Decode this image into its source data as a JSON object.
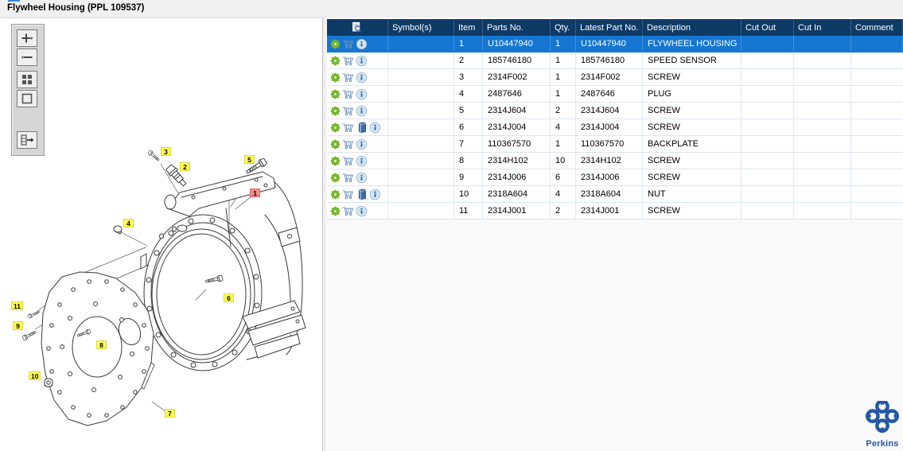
{
  "window": {
    "title": "Flywheel Housing (PPL 109537)"
  },
  "toolbar": {
    "buttons": [
      {
        "name": "zoom-in"
      },
      {
        "name": "zoom-out"
      },
      {
        "name": "zoom-fit"
      },
      {
        "name": "zoom-full-view"
      },
      {
        "name": "toggle-parts-panel"
      }
    ]
  },
  "diagram": {
    "callouts": [
      {
        "label": "1",
        "selected": true
      },
      {
        "label": "2"
      },
      {
        "label": "3"
      },
      {
        "label": "4"
      },
      {
        "label": "5"
      },
      {
        "label": "6"
      },
      {
        "label": "7"
      },
      {
        "label": "8"
      },
      {
        "label": "9"
      },
      {
        "label": "10"
      },
      {
        "label": "11"
      }
    ]
  },
  "table": {
    "columns": [
      "Symbol(s)",
      "Item",
      "Parts No.",
      "Qty.",
      "Latest Part No.",
      "Description",
      "Cut Out",
      "Cut In",
      "Comment"
    ],
    "rows": [
      {
        "item": "1",
        "parts_no": "U10447940",
        "qty": "1",
        "latest_part_no": "U10447940",
        "description": "FLYWHEEL HOUSING",
        "symbols": "",
        "cut_out": "",
        "cut_in": "",
        "comment": "",
        "selected": true,
        "has_book": false
      },
      {
        "item": "2",
        "parts_no": "185746180",
        "qty": "1",
        "latest_part_no": "185746180",
        "description": "SPEED SENSOR",
        "symbols": "",
        "cut_out": "",
        "cut_in": "",
        "comment": "",
        "selected": false,
        "has_book": false
      },
      {
        "item": "3",
        "parts_no": "2314F002",
        "qty": "1",
        "latest_part_no": "2314F002",
        "description": "SCREW",
        "symbols": "",
        "cut_out": "",
        "cut_in": "",
        "comment": "",
        "selected": false,
        "has_book": false
      },
      {
        "item": "4",
        "parts_no": "2487646",
        "qty": "1",
        "latest_part_no": "2487646",
        "description": "PLUG",
        "symbols": "",
        "cut_out": "",
        "cut_in": "",
        "comment": "",
        "selected": false,
        "has_book": false
      },
      {
        "item": "5",
        "parts_no": "2314J604",
        "qty": "2",
        "latest_part_no": "2314J604",
        "description": "SCREW",
        "symbols": "",
        "cut_out": "",
        "cut_in": "",
        "comment": "",
        "selected": false,
        "has_book": false
      },
      {
        "item": "6",
        "parts_no": "2314J004",
        "qty": "4",
        "latest_part_no": "2314J004",
        "description": "SCREW",
        "symbols": "",
        "cut_out": "",
        "cut_in": "",
        "comment": "",
        "selected": false,
        "has_book": true
      },
      {
        "item": "7",
        "parts_no": "110367570",
        "qty": "1",
        "latest_part_no": "110367570",
        "description": "BACKPLATE",
        "symbols": "",
        "cut_out": "",
        "cut_in": "",
        "comment": "",
        "selected": false,
        "has_book": false
      },
      {
        "item": "8",
        "parts_no": "2314H102",
        "qty": "10",
        "latest_part_no": "2314H102",
        "description": "SCREW",
        "symbols": "",
        "cut_out": "",
        "cut_in": "",
        "comment": "",
        "selected": false,
        "has_book": false
      },
      {
        "item": "9",
        "parts_no": "2314J006",
        "qty": "6",
        "latest_part_no": "2314J006",
        "description": "SCREW",
        "symbols": "",
        "cut_out": "",
        "cut_in": "",
        "comment": "",
        "selected": false,
        "has_book": false
      },
      {
        "item": "10",
        "parts_no": "2318A604",
        "qty": "4",
        "latest_part_no": "2318A604",
        "description": "NUT",
        "symbols": "",
        "cut_out": "",
        "cut_in": "",
        "comment": "",
        "selected": false,
        "has_book": true
      },
      {
        "item": "11",
        "parts_no": "2314J001",
        "qty": "2",
        "latest_part_no": "2314J001",
        "description": "SCREW",
        "symbols": "",
        "cut_out": "",
        "cut_in": "",
        "comment": "",
        "selected": false,
        "has_book": false
      }
    ]
  },
  "branding": {
    "logo_text": "Perkins"
  },
  "colors": {
    "header_bg": "#0e3a66",
    "selected_row": "#1577d2",
    "callout_yellow": "#ffff4f",
    "callout_selected": "#f28b8b",
    "gear_green": "#76b82a",
    "cart_blue": "#7191bf",
    "perkins_blue": "#2458a5"
  }
}
